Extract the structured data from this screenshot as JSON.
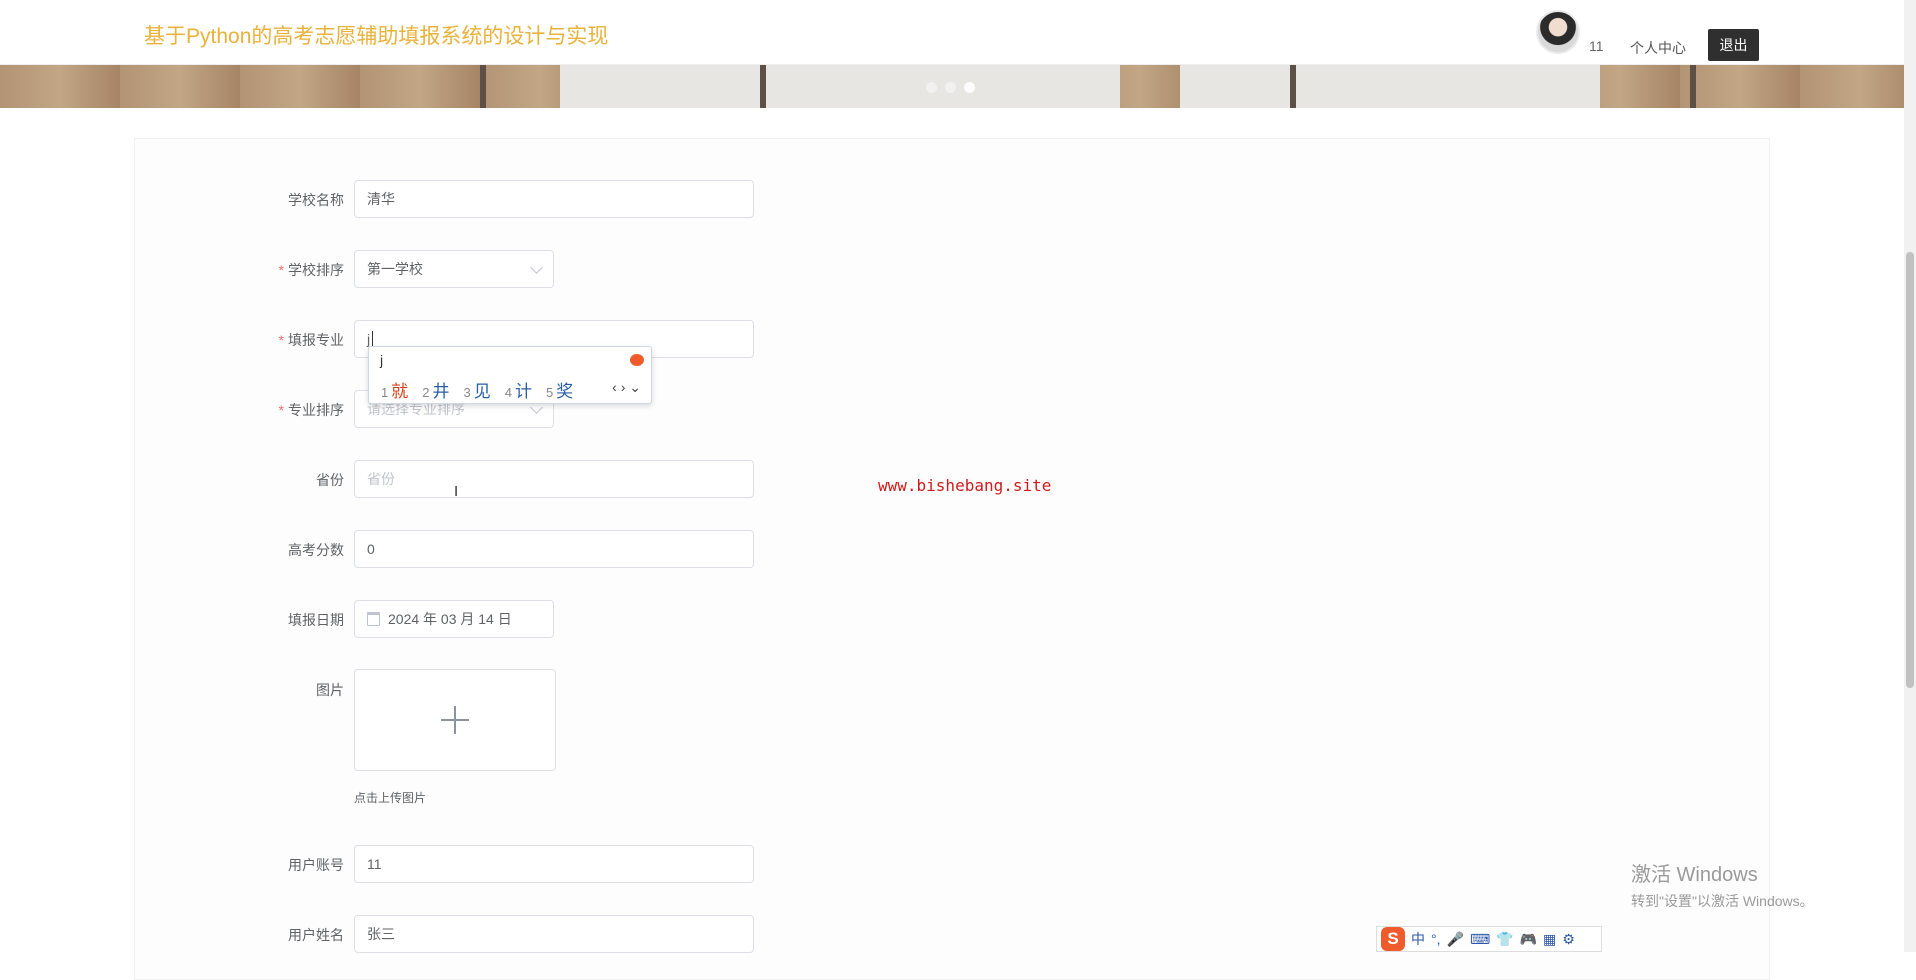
{
  "header": {
    "site_title": "基于Python的高考志愿辅助填报系统的设计与实现",
    "user_id": "11",
    "profile_link": "个人中心",
    "logout_label": "退出"
  },
  "banner": {
    "dots": [
      false,
      false,
      true
    ]
  },
  "form": {
    "school_name": {
      "label": "学校名称",
      "value": "清华"
    },
    "school_rank": {
      "label": "学校排序",
      "value": "第一学校"
    },
    "major": {
      "label": "填报专业",
      "value": "j"
    },
    "major_rank": {
      "label": "专业排序",
      "placeholder": "请选择专业排序"
    },
    "province": {
      "label": "省份",
      "placeholder": "省份"
    },
    "score": {
      "label": "高考分数",
      "value": "0"
    },
    "date": {
      "label": "填报日期",
      "value": "2024 年 03 月 14 日"
    },
    "image": {
      "label": "图片",
      "tip": "点击上传图片"
    },
    "account": {
      "label": "用户账号",
      "value": "11"
    },
    "name": {
      "label": "用户姓名",
      "value": "张三"
    }
  },
  "ime_popup": {
    "pinyin": "j",
    "candidates": [
      {
        "num": "1",
        "text": "就"
      },
      {
        "num": "2",
        "text": "井"
      },
      {
        "num": "3",
        "text": "见"
      },
      {
        "num": "4",
        "text": "计"
      },
      {
        "num": "5",
        "text": "奖"
      }
    ],
    "nav": "‹ › ⌄"
  },
  "watermark": "www.bishebang.site",
  "text_cursor": "I",
  "windows_activation": {
    "line1": "激活 Windows",
    "line2": "转到\"设置\"以激活 Windows。"
  },
  "ime_bar": {
    "logo": "S",
    "items": [
      "中",
      "°,",
      "🎤",
      "⌨",
      "👕",
      "🎮",
      "▦",
      "⚙"
    ]
  },
  "colors": {
    "title": "#e9b23a",
    "required": "#f56c6c",
    "watermark": "#d01b1b",
    "logout_bg": "#2f2f2f"
  }
}
